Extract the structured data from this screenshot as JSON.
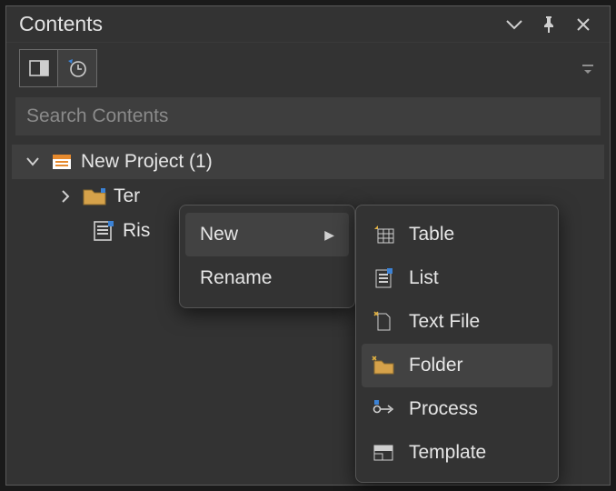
{
  "panel": {
    "title": "Contents",
    "search_placeholder": "Search Contents"
  },
  "tree": {
    "root": {
      "label": "New Project (1)"
    },
    "items": [
      {
        "label": "Ter"
      },
      {
        "label": "Ris"
      }
    ]
  },
  "context_menu": {
    "items": [
      {
        "label": "New"
      },
      {
        "label": "Rename"
      }
    ]
  },
  "submenu": {
    "items": [
      {
        "label": "Table"
      },
      {
        "label": "List"
      },
      {
        "label": "Text File"
      },
      {
        "label": "Folder"
      },
      {
        "label": "Process"
      },
      {
        "label": "Template"
      }
    ]
  }
}
